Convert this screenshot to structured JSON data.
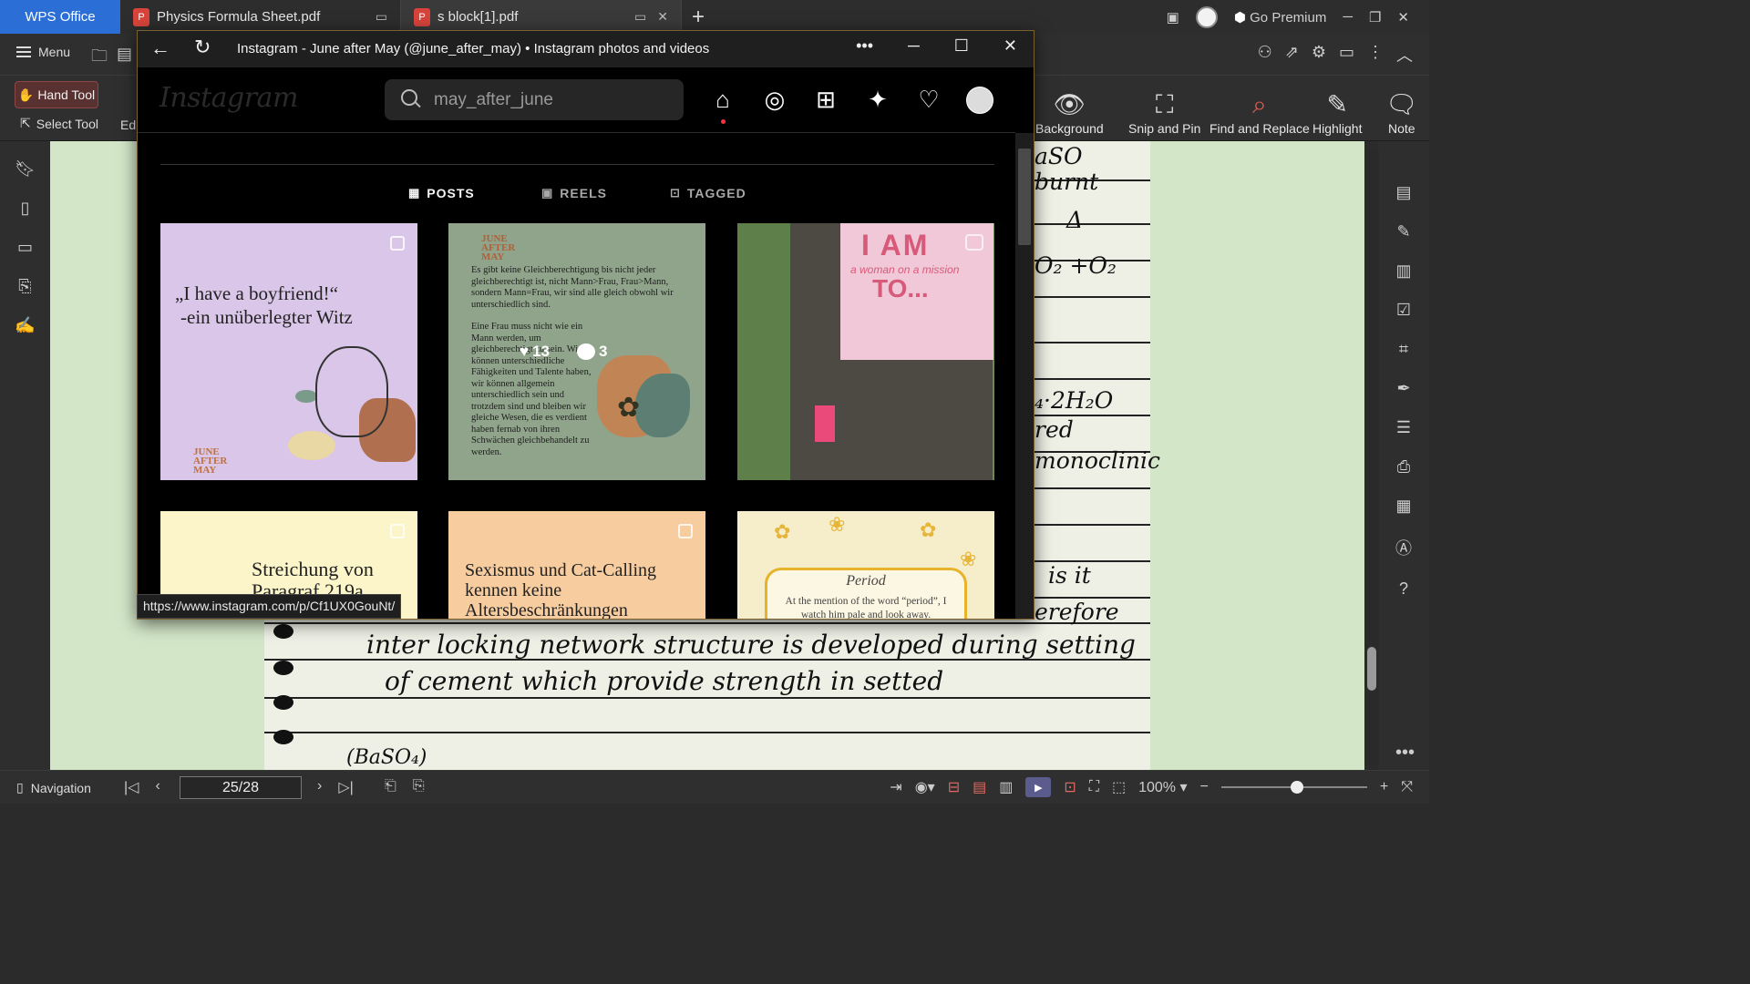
{
  "window": {
    "app_tab": "WPS Office",
    "tabs": [
      {
        "label": "Physics Formula Sheet.pdf"
      },
      {
        "label": "s block[1].pdf"
      }
    ],
    "go_premium": "Go Premium"
  },
  "menubar": {
    "menu_label": "Menu"
  },
  "ribbon": {
    "hand_tool": "Hand Tool",
    "select_tool": "Select Tool",
    "edit_trunc": "Edi",
    "background": "Background",
    "snip_and_pin": "Snip and Pin",
    "find_and_replace": "Find and Replace",
    "highlight": "Highlight",
    "note": "Note"
  },
  "document": {
    "handwriting": [
      "aSO",
      "burnt",
      "Δ",
      "O₂ +O₂",
      "₄·2H₂O",
      "red",
      "monoclinic",
      "is it",
      "erefore",
      "inter locking network structure is developed during setting",
      "of cement which provide strength in setted",
      "(BaSO₄)"
    ]
  },
  "statusbar": {
    "navigation": "Navigation",
    "page_indicator": "25/28",
    "zoom": "100%"
  },
  "instagram": {
    "window_title": "Instagram - June after May (@june_after_may) • Instagram photos and videos",
    "logo": "Instagram",
    "search_value": "may_after_june",
    "tabs": [
      {
        "label": "POSTS",
        "active": true
      },
      {
        "label": "REELS",
        "active": false
      },
      {
        "label": "TAGGED",
        "active": false
      }
    ],
    "posts": {
      "p1": {
        "quote": "„I have a boyfriend!“",
        "quote_line2": "-ein unüberlegter Witz",
        "brand": "JUNE AFTER MAY"
      },
      "p2": {
        "brand": "JUNE AFTER MAY",
        "text1": "Es gibt keine Gleichberechtigung bis nicht jeder gleichberechtigt ist, nicht Mann>Frau, Frau>Mann, sondern Mann=Frau, wir sind alle gleich obwohl wir unterschiedlich sind.",
        "text2": "Eine Frau muss nicht wie ein Mann werden, um gleichberechtigt zu sein. Wir können unterschiedliche Fähigkeiten und Talente haben, wir können allgemein unterschiedlich sein und trotzdem sind und bleiben wir gleiche Wesen, die es verdient haben fernab von ihren Schwächen gleichbehandelt zu werden.",
        "likes": "13",
        "comments": "3"
      },
      "p3": {
        "sign_title": "I AM",
        "sign_sub": "a woman on a mission",
        "sign_to": "TO..."
      },
      "p4": {
        "text": "Streichung von Paragraf 219a"
      },
      "p5": {
        "text": "Sexismus und Cat-Calling kennen keine Altersbeschränkungen"
      },
      "p6": {
        "title": "Period",
        "text": "At the mention of the word “period”, I watch him pale and look away."
      }
    },
    "hover_url": "https://www.instagram.com/p/Cf1UX0GouNt/"
  }
}
